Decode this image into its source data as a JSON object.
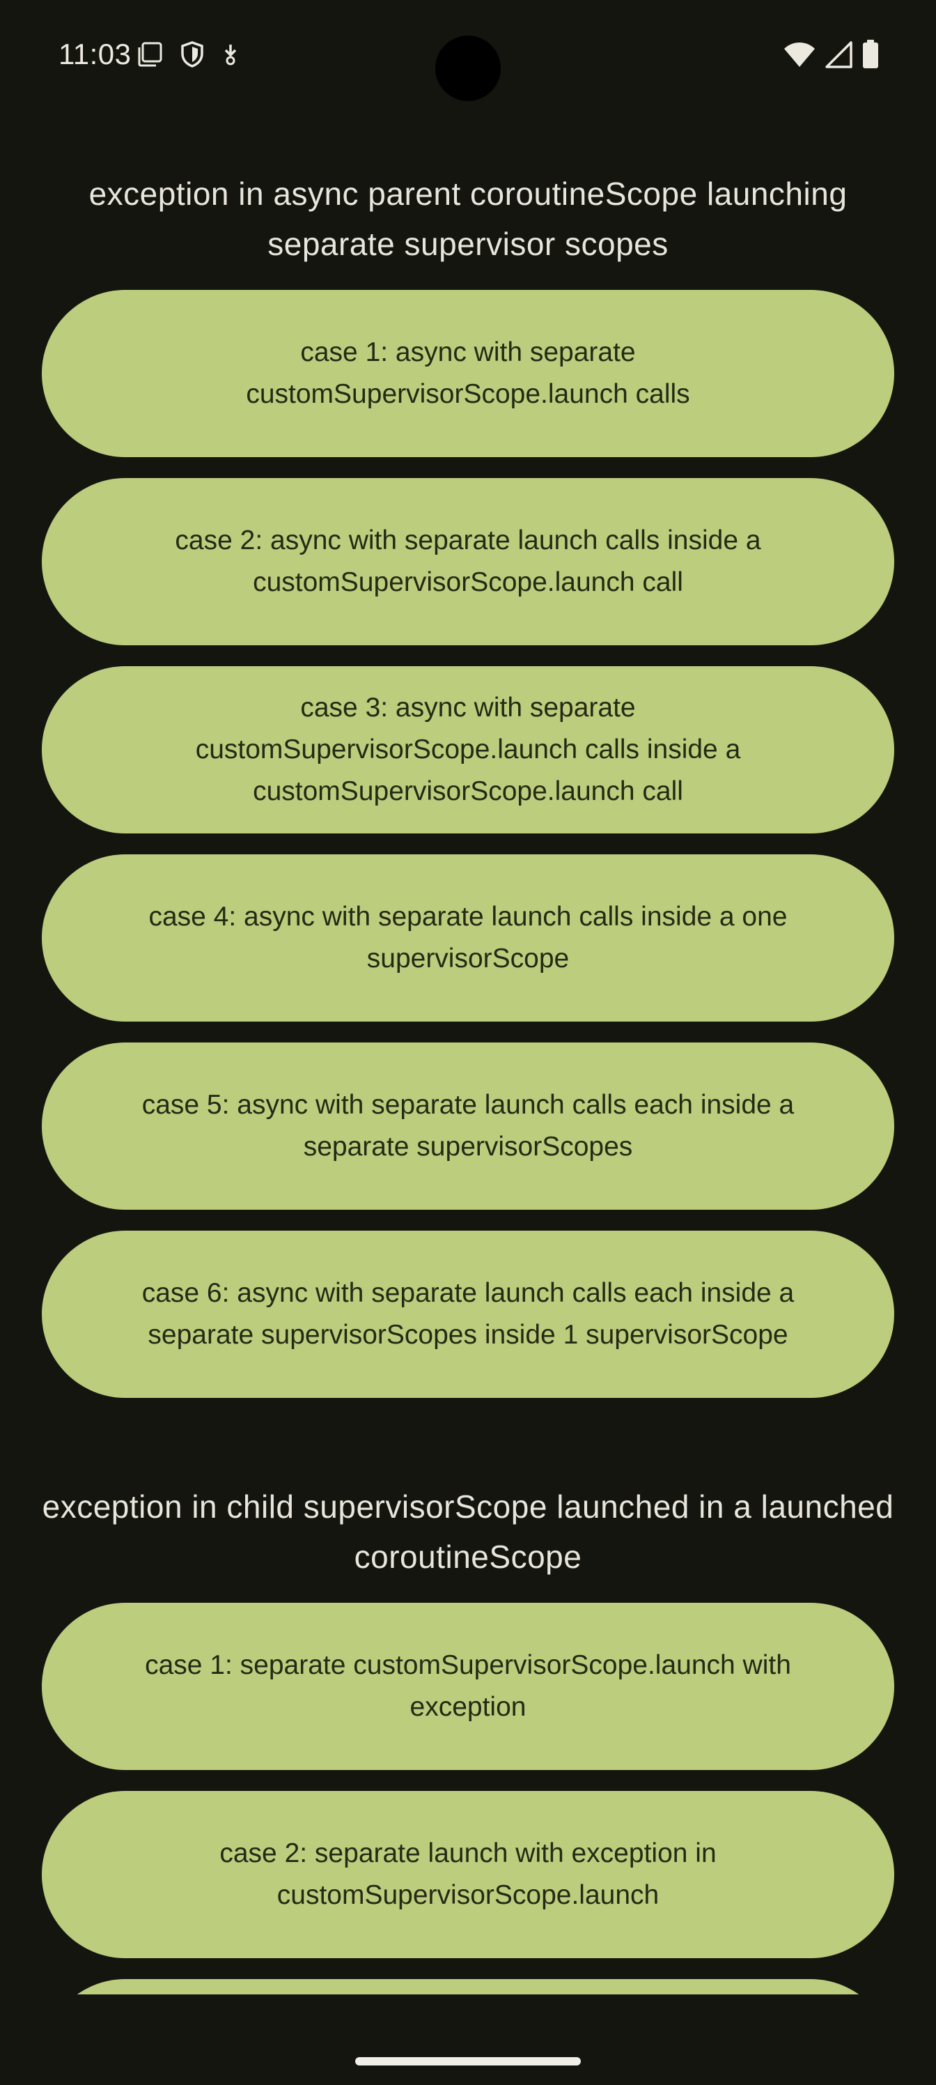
{
  "status_bar": {
    "time": "11:03",
    "left_icons": [
      "screenshot-icon",
      "shield-icon",
      "download-icon"
    ],
    "right_icons": [
      "wifi-icon",
      "signal-icon",
      "battery-icon"
    ]
  },
  "sections": [
    {
      "title": "exception in async parent coroutineScope launching separate supervisor scopes",
      "buttons": [
        "case 1: async with separate customSupervisorScope.launch calls",
        "case 2: async with separate launch calls inside a customSupervisorScope.launch call",
        "case 3: async with separate customSupervisorScope.launch calls inside a customSupervisorScope.launch call",
        "case 4: async with separate launch calls inside a one supervisorScope",
        "case 5: async with separate launch calls each inside a separate supervisorScopes",
        "case 6: async with separate launch calls each inside a separate supervisorScopes inside 1 supervisorScope"
      ]
    },
    {
      "title": "exception in child supervisorScope launched in a launched coroutineScope",
      "buttons": [
        "case 1: separate customSupervisorScope.launch with exception",
        "case 2: separate launch with exception in customSupervisorScope.launch",
        ""
      ]
    }
  ],
  "colors": {
    "background": "#14150f",
    "button": "#bccd7e",
    "button_text": "#252a14",
    "title_text": "#e8e6dc"
  }
}
